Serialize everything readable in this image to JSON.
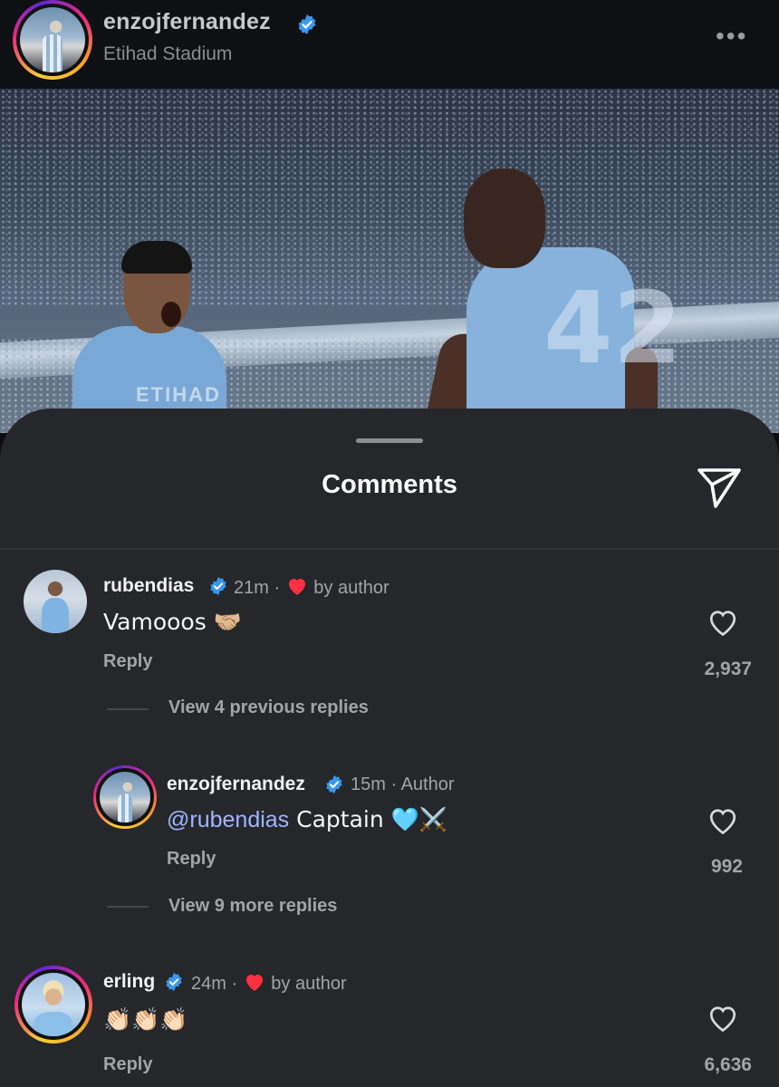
{
  "post": {
    "username": "enzojfernandez",
    "location": "Etihad Stadium",
    "shirt_number": "42",
    "shirt_sponsor": "ETIHAD"
  },
  "sheet": {
    "title": "Comments"
  },
  "comments": [
    {
      "username": "rubendias",
      "time": "21m",
      "separator": "·",
      "badge": "by author",
      "text": "Vamooos 🤝🏼",
      "reply_label": "Reply",
      "likes": "2,937",
      "view_replies": "View 4 previous replies"
    },
    {
      "username": "enzojfernandez",
      "time": "15m",
      "separator": "·",
      "badge": "Author",
      "mention": "@rubendias",
      "text": " Captain 🩵⚔️",
      "reply_label": "Reply",
      "likes": "992",
      "view_replies": "View 9 more replies"
    },
    {
      "username": "erling",
      "time": "24m",
      "separator": "·",
      "badge": "by author",
      "text": "👏🏻👏🏻👏🏻",
      "reply_label": "Reply",
      "likes": "6,636"
    }
  ],
  "icons": {
    "verified": "verified-badge-icon",
    "more": "more-options-icon",
    "share": "share-icon",
    "like": "heart-outline-icon",
    "author_like": "red-heart-icon"
  },
  "colors": {
    "sheet_bg": "#26272b",
    "verified_blue": "#3897f0",
    "heart_red": "#ff3040",
    "mention": "#9fb6ff"
  }
}
